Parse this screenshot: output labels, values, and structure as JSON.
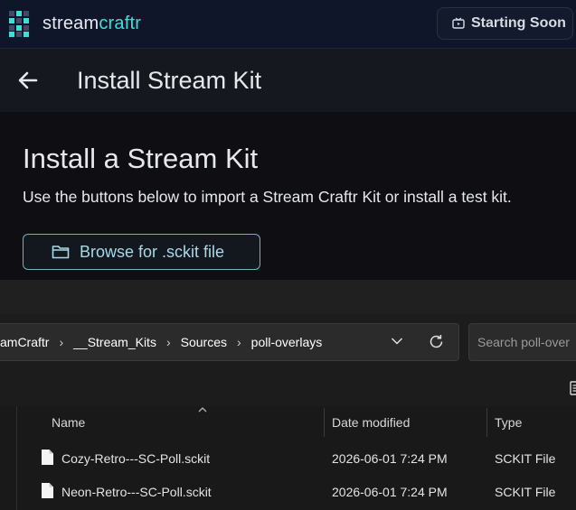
{
  "app": {
    "brand_part1": "stream",
    "brand_part2": "craftr",
    "status_label": "Starting Soon",
    "accent_color": "#3ee0d6"
  },
  "header": {
    "back_icon": "back-arrow-icon",
    "title": "Install Stream Kit"
  },
  "main": {
    "heading": "Install a Stream Kit",
    "description": "Use the buttons below to import a Stream Craftr Kit or install a test kit.",
    "browse_button_label": "Browse for .sckit file"
  },
  "file_dialog": {
    "breadcrumb": [
      "amCraftr",
      "__Stream_Kits",
      "Sources",
      "poll-overlays"
    ],
    "search_placeholder": "Search poll-over",
    "columns": [
      "Name",
      "Date modified",
      "Type"
    ],
    "files": [
      {
        "name": "Cozy-Retro---SC-Poll.sckit",
        "date_modified": "2026-06-01 7:24 PM",
        "type": "SCKIT File"
      },
      {
        "name": "Neon-Retro---SC-Poll.sckit",
        "date_modified": "2026-06-01 7:24 PM",
        "type": "SCKIT File"
      }
    ]
  }
}
